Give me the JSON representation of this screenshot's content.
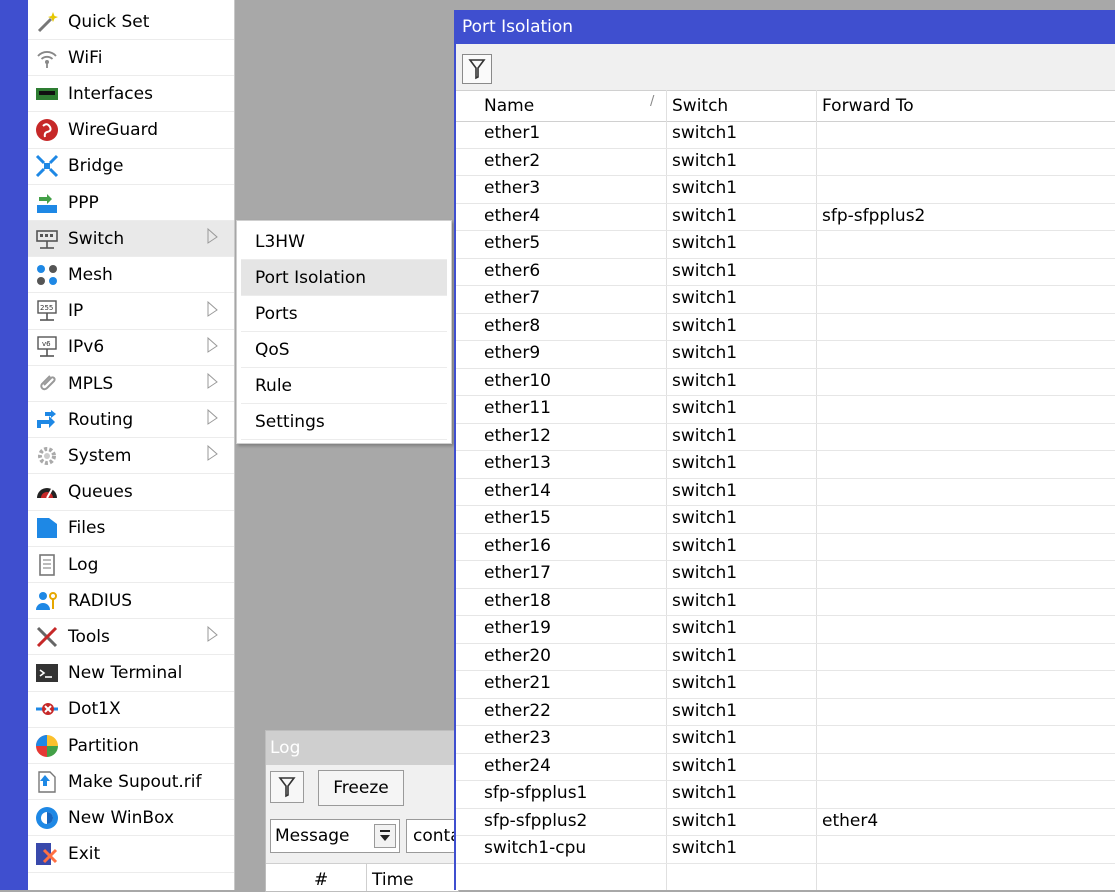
{
  "sidebar": {
    "items": [
      {
        "label": "Quick Set",
        "icon": "magic-wand-icon",
        "has_submenu": false
      },
      {
        "label": "WiFi",
        "icon": "wifi-icon",
        "has_submenu": false
      },
      {
        "label": "Interfaces",
        "icon": "network-card-icon",
        "has_submenu": false
      },
      {
        "label": "WireGuard",
        "icon": "wireguard-icon",
        "has_submenu": false
      },
      {
        "label": "Bridge",
        "icon": "bridge-icon",
        "has_submenu": false
      },
      {
        "label": "PPP",
        "icon": "ppp-icon",
        "has_submenu": false
      },
      {
        "label": "Switch",
        "icon": "switch-icon",
        "has_submenu": true
      },
      {
        "label": "Mesh",
        "icon": "mesh-icon",
        "has_submenu": false
      },
      {
        "label": "IP",
        "icon": "ip-icon",
        "has_submenu": true
      },
      {
        "label": "IPv6",
        "icon": "ipv6-icon",
        "has_submenu": true
      },
      {
        "label": "MPLS",
        "icon": "mpls-icon",
        "has_submenu": true
      },
      {
        "label": "Routing",
        "icon": "routing-icon",
        "has_submenu": true
      },
      {
        "label": "System",
        "icon": "gear-icon",
        "has_submenu": true
      },
      {
        "label": "Queues",
        "icon": "queues-icon",
        "has_submenu": false
      },
      {
        "label": "Files",
        "icon": "folder-icon",
        "has_submenu": false
      },
      {
        "label": "Log",
        "icon": "log-icon",
        "has_submenu": false
      },
      {
        "label": "RADIUS",
        "icon": "radius-icon",
        "has_submenu": false
      },
      {
        "label": "Tools",
        "icon": "tools-icon",
        "has_submenu": true
      },
      {
        "label": "New Terminal",
        "icon": "terminal-icon",
        "has_submenu": false
      },
      {
        "label": "Dot1X",
        "icon": "dot1x-icon",
        "has_submenu": false
      },
      {
        "label": "Partition",
        "icon": "partition-icon",
        "has_submenu": false
      },
      {
        "label": "Make Supout.rif",
        "icon": "supout-icon",
        "has_submenu": false
      },
      {
        "label": "New WinBox",
        "icon": "winbox-icon",
        "has_submenu": false
      },
      {
        "label": "Exit",
        "icon": "exit-icon",
        "has_submenu": false
      }
    ]
  },
  "submenu": {
    "items": [
      "L3HW",
      "Port Isolation",
      "Ports",
      "QoS",
      "Rule",
      "Settings"
    ]
  },
  "log_window": {
    "title": "Log",
    "freeze_label": "Freeze",
    "field_value": "Message",
    "condition_value": "conta",
    "columns": [
      "#",
      "Time"
    ]
  },
  "port_isolation": {
    "title": "Port Isolation",
    "columns": {
      "name": "Name",
      "switch": "Switch",
      "forward_to": "Forward To"
    },
    "rows": [
      {
        "name": "ether1",
        "switch": "switch1",
        "forward_to": ""
      },
      {
        "name": "ether2",
        "switch": "switch1",
        "forward_to": ""
      },
      {
        "name": "ether3",
        "switch": "switch1",
        "forward_to": ""
      },
      {
        "name": "ether4",
        "switch": "switch1",
        "forward_to": "sfp-sfpplus2"
      },
      {
        "name": "ether5",
        "switch": "switch1",
        "forward_to": ""
      },
      {
        "name": "ether6",
        "switch": "switch1",
        "forward_to": ""
      },
      {
        "name": "ether7",
        "switch": "switch1",
        "forward_to": ""
      },
      {
        "name": "ether8",
        "switch": "switch1",
        "forward_to": ""
      },
      {
        "name": "ether9",
        "switch": "switch1",
        "forward_to": ""
      },
      {
        "name": "ether10",
        "switch": "switch1",
        "forward_to": ""
      },
      {
        "name": "ether11",
        "switch": "switch1",
        "forward_to": ""
      },
      {
        "name": "ether12",
        "switch": "switch1",
        "forward_to": ""
      },
      {
        "name": "ether13",
        "switch": "switch1",
        "forward_to": ""
      },
      {
        "name": "ether14",
        "switch": "switch1",
        "forward_to": ""
      },
      {
        "name": "ether15",
        "switch": "switch1",
        "forward_to": ""
      },
      {
        "name": "ether16",
        "switch": "switch1",
        "forward_to": ""
      },
      {
        "name": "ether17",
        "switch": "switch1",
        "forward_to": ""
      },
      {
        "name": "ether18",
        "switch": "switch1",
        "forward_to": ""
      },
      {
        "name": "ether19",
        "switch": "switch1",
        "forward_to": ""
      },
      {
        "name": "ether20",
        "switch": "switch1",
        "forward_to": ""
      },
      {
        "name": "ether21",
        "switch": "switch1",
        "forward_to": ""
      },
      {
        "name": "ether22",
        "switch": "switch1",
        "forward_to": ""
      },
      {
        "name": "ether23",
        "switch": "switch1",
        "forward_to": ""
      },
      {
        "name": "ether24",
        "switch": "switch1",
        "forward_to": ""
      },
      {
        "name": "sfp-sfpplus1",
        "switch": "switch1",
        "forward_to": ""
      },
      {
        "name": "sfp-sfpplus2",
        "switch": "switch1",
        "forward_to": "ether4"
      },
      {
        "name": "switch1-cpu",
        "switch": "switch1",
        "forward_to": ""
      }
    ]
  },
  "colors": {
    "accent": "#3f4fcf",
    "desktop": "#a8a8a8"
  }
}
